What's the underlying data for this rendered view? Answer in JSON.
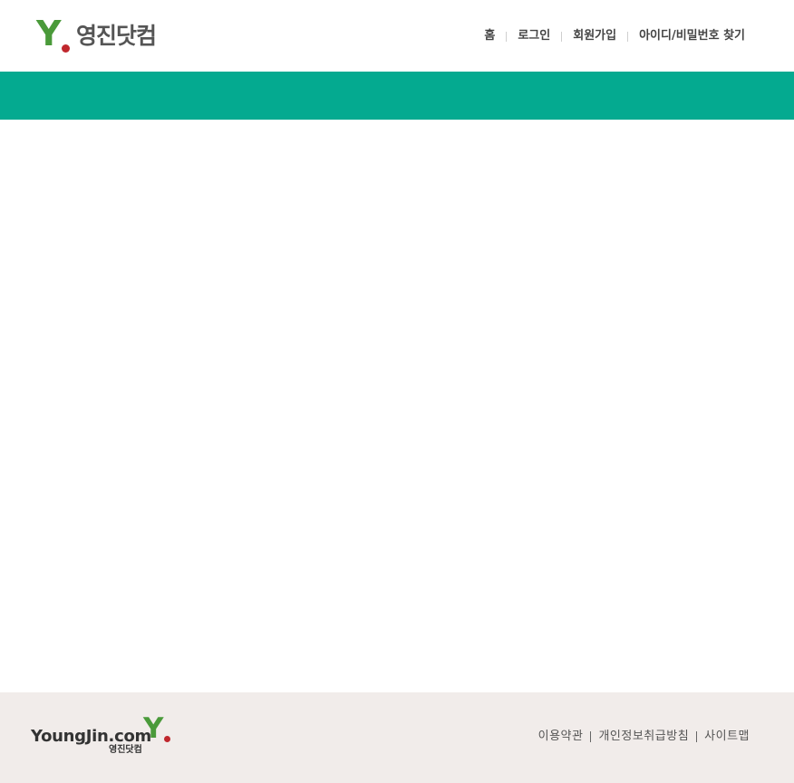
{
  "header": {
    "logo": {
      "mark": "Y",
      "text": "영진닷컴"
    },
    "nav": [
      {
        "label": "홈"
      },
      {
        "label": "로그인"
      },
      {
        "label": "회원가입"
      },
      {
        "label": "아이디/비밀번호 찾기"
      }
    ]
  },
  "band": {
    "color": "#04aa90"
  },
  "footer": {
    "logo": {
      "brand_en": "YoungJin.com",
      "brand_ko": "영진닷컴",
      "mark": "Y"
    },
    "links": [
      {
        "label": "이용약관"
      },
      {
        "label": "개인정보취급방침"
      },
      {
        "label": "사이트맵"
      }
    ]
  },
  "colors": {
    "brand_green": "#4a9a3a",
    "brand_red": "#c0272d",
    "footer_bg": "#f1ecea"
  }
}
